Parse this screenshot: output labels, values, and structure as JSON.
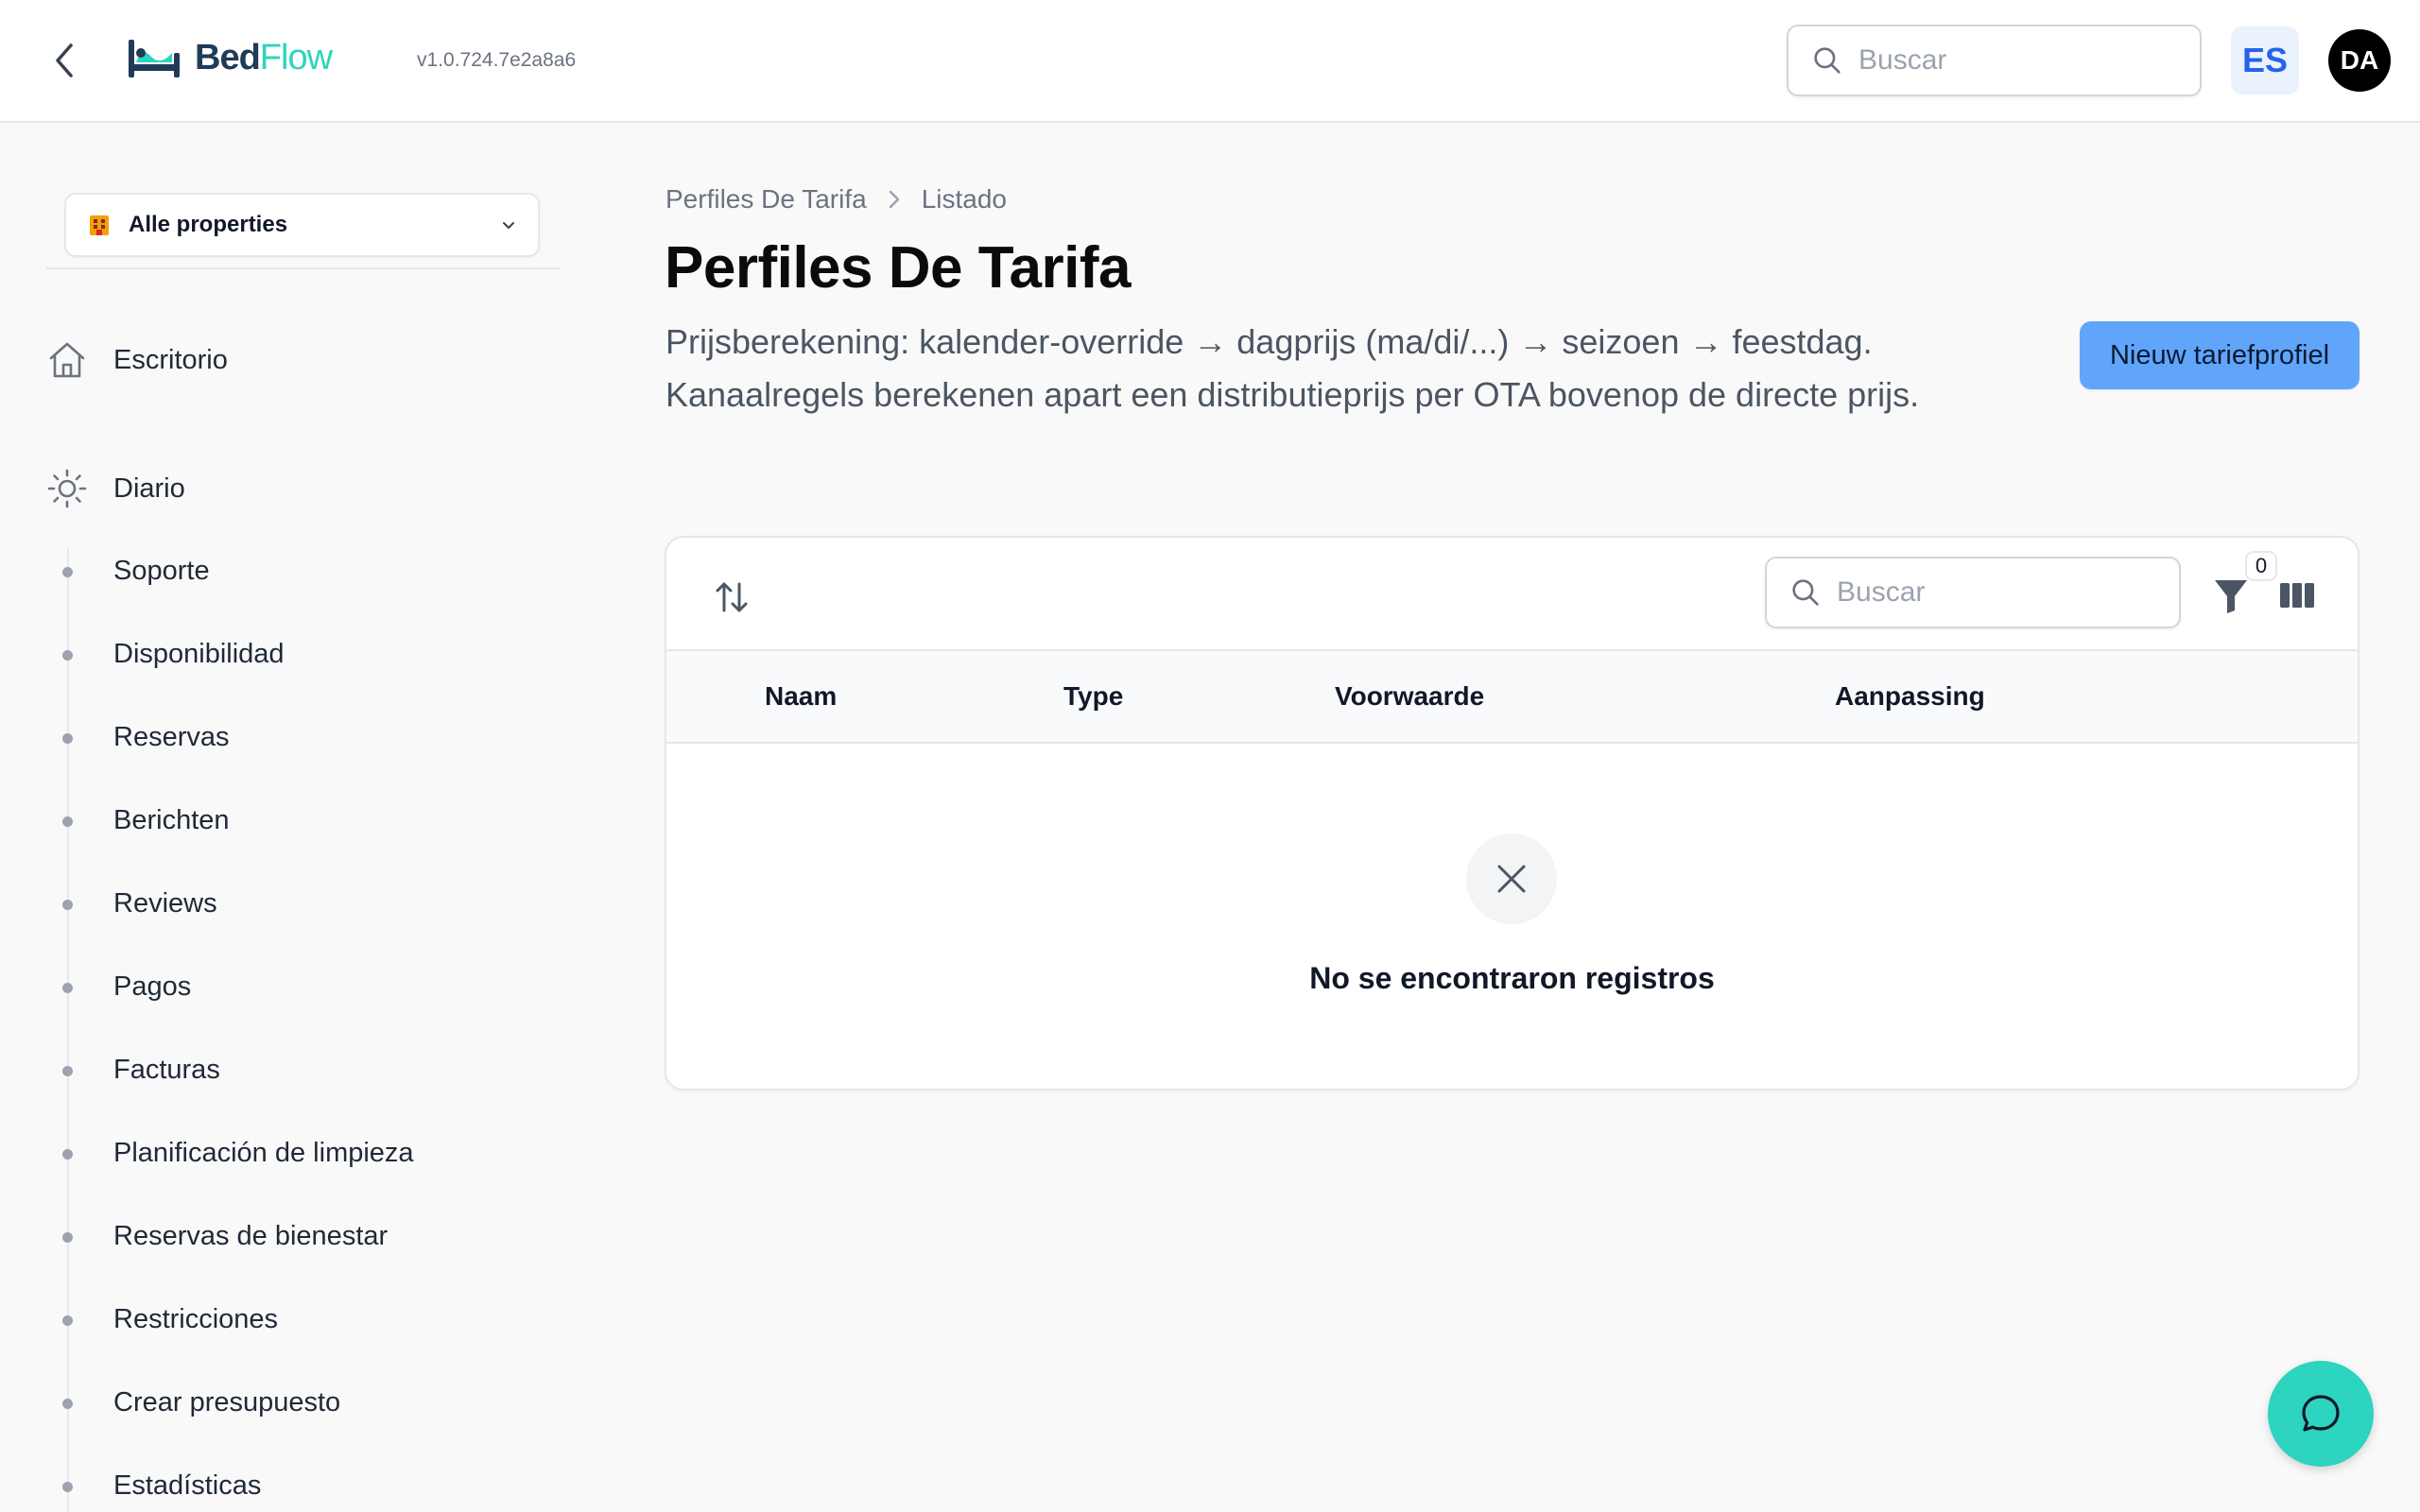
{
  "header": {
    "logo_text_bed": "Bed",
    "logo_text_flow": "Flow",
    "version": "v1.0.724.7e2a8a6",
    "search_placeholder": "Buscar",
    "language": "ES",
    "avatar_initials": "DA"
  },
  "sidebar": {
    "property_selector": "Alle properties",
    "top_items": [
      {
        "label": "Escritorio",
        "icon": "home-icon"
      },
      {
        "label": "Diario",
        "icon": "sun-icon"
      }
    ],
    "sub_items": [
      "Soporte",
      "Disponibilidad",
      "Reservas",
      "Berichten",
      "Reviews",
      "Pagos",
      "Facturas",
      "Planificación de limpieza",
      "Reservas de bienestar",
      "Restricciones",
      "Crear presupuesto",
      "Estadísticas"
    ]
  },
  "main": {
    "breadcrumb": [
      "Perfiles De Tarifa",
      "Listado"
    ],
    "title": "Perfiles De Tarifa",
    "description": "Prijsberekening: kalender-override → dagprijs (ma/di/...) → seizoen → feestdag. Kanaalregels berekenen apart een distributieprijs per OTA bovenop de directe prijs.",
    "new_button": "Nieuw tariefprofiel",
    "table": {
      "search_placeholder": "Buscar",
      "filter_count": "0",
      "columns": [
        "Naam",
        "Type",
        "Voorwaarde",
        "Aanpassing"
      ],
      "empty_message": "No se encontraron registros"
    }
  },
  "colors": {
    "accent": "#2dd4bf",
    "primary_button": "#60a5fa",
    "language_text": "#2563eb"
  }
}
